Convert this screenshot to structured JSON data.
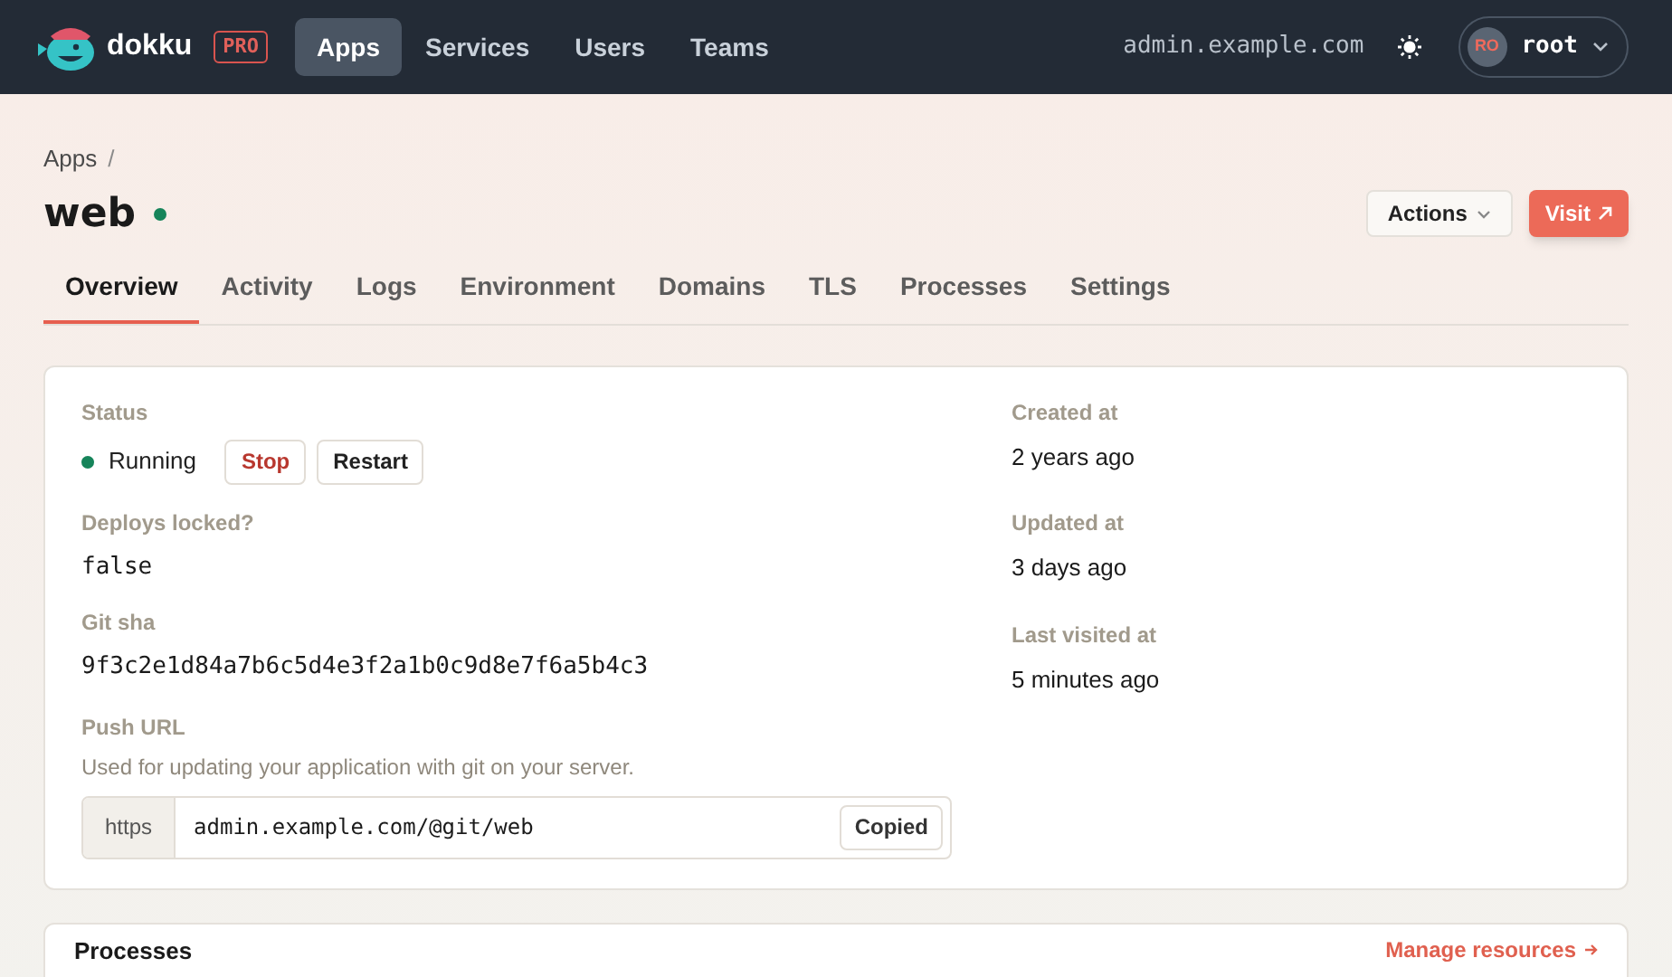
{
  "brand": {
    "name": "dokku",
    "badge": "PRO"
  },
  "nav": [
    {
      "label": "Apps",
      "selected": true
    },
    {
      "label": "Services",
      "selected": false
    },
    {
      "label": "Users",
      "selected": false
    },
    {
      "label": "Teams",
      "selected": false
    }
  ],
  "host": "admin.example.com",
  "user": {
    "initials": "RO",
    "name": "root"
  },
  "breadcrumb": [
    "Apps",
    "/"
  ],
  "app": {
    "name": "web",
    "running": true
  },
  "actions": {
    "menu": "Actions",
    "visit": "Visit"
  },
  "tabs": [
    {
      "label": "Overview",
      "selected": true
    },
    {
      "label": "Activity",
      "selected": false
    },
    {
      "label": "Logs",
      "selected": false
    },
    {
      "label": "Environment",
      "selected": false
    },
    {
      "label": "Domains",
      "selected": false
    },
    {
      "label": "TLS",
      "selected": false
    },
    {
      "label": "Processes",
      "selected": false
    },
    {
      "label": "Settings",
      "selected": false
    }
  ],
  "overview": {
    "status_label": "Status",
    "status": "Running",
    "stop": "Stop",
    "restart": "Restart",
    "fields": [
      {
        "label": "Deploys locked?",
        "value": "false"
      },
      {
        "label": "Git sha",
        "value": "9f3c2e1d84a7b6c5d4e3f2a1b0c9d8e7f6a5b4c3"
      }
    ],
    "push_url": {
      "label": "Push URL",
      "description": "Used for updating your application with git on your server.",
      "prefix": "https",
      "value": "admin.example.com/@git/web",
      "copy": "Copied"
    },
    "times": [
      {
        "label": "Created at",
        "value": "2 years ago"
      },
      {
        "label": "Updated at",
        "value": "3 days ago"
      },
      {
        "label": "Last visited at",
        "value": "5 minutes ago"
      }
    ]
  },
  "processes": {
    "title": "Processes",
    "link": "Manage resources"
  }
}
